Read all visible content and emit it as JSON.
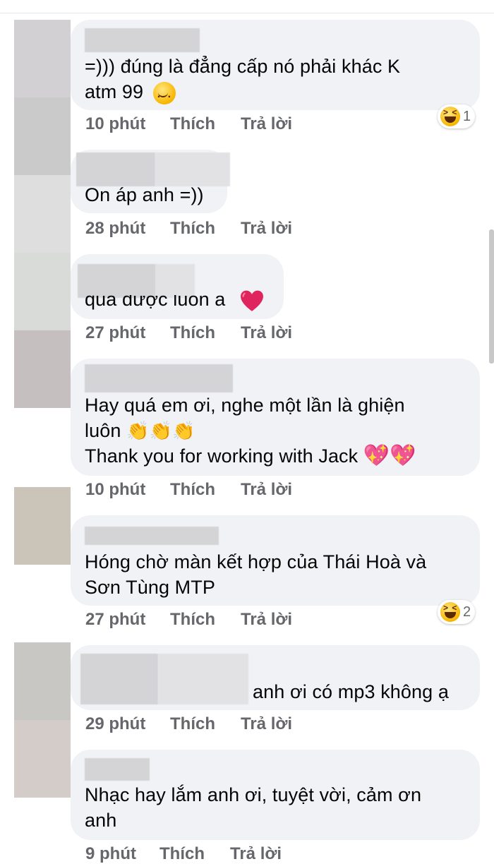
{
  "comments": [
    {
      "text_lines": [
        "=))) đúng là đẳng cấp nó phải khác K",
        "atm 99"
      ],
      "time": "10 phút",
      "like": "Thích",
      "reply": "Trả lời",
      "reaction_count": "1"
    },
    {
      "text_lines": [
        "On áp anh =))"
      ],
      "time": "28 phút",
      "like": "Thích",
      "reply": "Trả lời"
    },
    {
      "text_lines": [
        "quá được luôn a"
      ],
      "time": "27 phút",
      "like": "Thích",
      "reply": "Trả lời"
    },
    {
      "text_lines": [
        "Hay quá em ơi, nghe một lần là ghiện",
        "luôn",
        "Thank you for working with Jack"
      ],
      "time": "10 phút",
      "like": "Thích",
      "reply": "Trả lời"
    },
    {
      "text_lines": [
        "Hóng chờ màn kết hợp của Thái Hoà và",
        "Sơn Tùng MTP"
      ],
      "time": "27 phút",
      "like": "Thích",
      "reply": "Trả lời",
      "reaction_count": "2"
    },
    {
      "text_lines": [
        "anh ơi có mp3 không ạ"
      ],
      "time": "29 phút",
      "like": "Thích",
      "reply": "Trả lời"
    },
    {
      "text_lines": [
        "Nhạc hay lắm anh ơi, tuyệt vời, cảm ơn",
        "anh"
      ],
      "time": "9 phút",
      "like": "Thích",
      "reply": "Trả lời"
    }
  ],
  "icons": {
    "laugh_reaction": "laughing-face-icon",
    "smile": "smiling-face-icon",
    "heart": "red-heart-icon",
    "clap": "clapping-hands-icon",
    "sparkling_heart": "sparkling-heart-icon"
  },
  "colors": {
    "bubble": "#f0f2f5",
    "meta_text": "#65676b",
    "heart": "#e0245e"
  }
}
